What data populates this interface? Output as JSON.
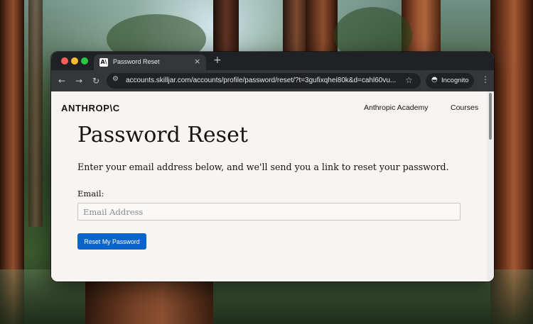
{
  "browser": {
    "tab_title": "Password Reset",
    "tab_favicon_text": "A\\",
    "tab_close": "×",
    "new_tab": "+",
    "url": "accounts.skilljar.com/accounts/profile/password/reset/?t=3gufixqhei80k&d=cahl60vu...",
    "incognito_label": "Incognito",
    "icons": {
      "back": "arrow-left-icon",
      "forward": "arrow-right-icon",
      "reload": "reload-icon",
      "site_info": "site-info-icon",
      "bookmark": "star-icon",
      "incognito": "incognito-icon",
      "menu": "more-vert-icon"
    }
  },
  "site": {
    "logo": "ANTHROP\\C",
    "nav": [
      "Anthropic Academy",
      "Courses"
    ]
  },
  "form": {
    "heading": "Password Reset",
    "intro": "Enter your email address below, and we'll send you a link to reset your password.",
    "email_label": "Email:",
    "email_placeholder": "Email Address",
    "email_value": "",
    "submit_label": "Reset My Password"
  },
  "colors": {
    "page_background": "#f7f4f1",
    "button": "#0b64c9",
    "browser_chrome": "#35363a"
  }
}
